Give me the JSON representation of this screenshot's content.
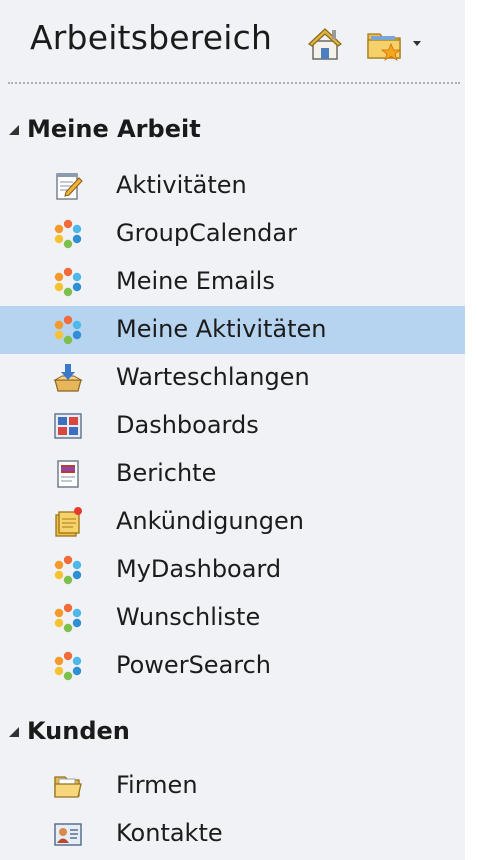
{
  "header": {
    "title": "Arbeitsbereich"
  },
  "groups": [
    {
      "label": "Meine Arbeit",
      "items": [
        {
          "label": "Aktivitäten",
          "icon": "notepad-pencil-icon"
        },
        {
          "label": "GroupCalendar",
          "icon": "colored-dots-icon"
        },
        {
          "label": "Meine Emails",
          "icon": "colored-dots-icon"
        },
        {
          "label": "Meine Aktivitäten",
          "icon": "colored-dots-icon",
          "selected": true
        },
        {
          "label": "Warteschlangen",
          "icon": "inbox-tray-icon"
        },
        {
          "label": "Dashboards",
          "icon": "dashboard-grid-icon"
        },
        {
          "label": "Berichte",
          "icon": "report-document-icon"
        },
        {
          "label": "Ankündigungen",
          "icon": "announcement-note-icon"
        },
        {
          "label": "MyDashboard",
          "icon": "colored-dots-icon"
        },
        {
          "label": "Wunschliste",
          "icon": "colored-dots-icon"
        },
        {
          "label": "PowerSearch",
          "icon": "colored-dots-icon"
        }
      ]
    },
    {
      "label": "Kunden",
      "items": [
        {
          "label": "Firmen",
          "icon": "open-folder-icon"
        },
        {
          "label": "Kontakte",
          "icon": "contact-card-icon"
        }
      ]
    }
  ],
  "colors": {
    "selected_bg": "#b6d3ef",
    "panel_bg": "#f0f2f6"
  }
}
